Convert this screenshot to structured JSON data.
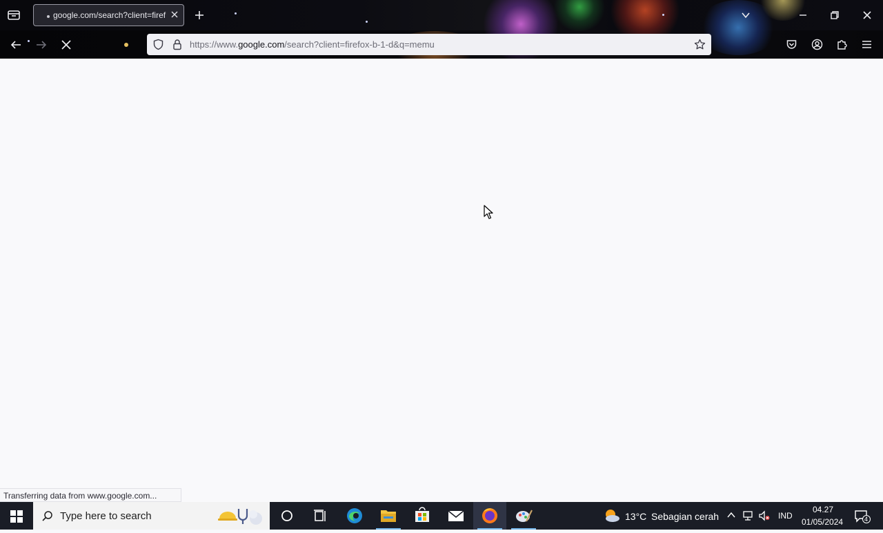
{
  "browser": {
    "tab": {
      "title": "google.com/search?client=firef"
    },
    "url": {
      "prefix": "https://www.",
      "domain": "google.com",
      "rest": "/search?client=firefox-b-1-d&q=memu"
    },
    "icons": {
      "tab_list": "tab-list-icon",
      "close_tab": "close-icon",
      "new_tab": "plus-icon",
      "list_all_tabs": "chevron-down-icon",
      "minimize": "minimize-icon",
      "restore": "restore-icon",
      "close_window": "close-icon",
      "back": "back-arrow-icon",
      "forward": "forward-arrow-icon",
      "stop": "stop-icon",
      "shield": "shield-icon",
      "lock": "lock-icon",
      "bookmark": "star-icon",
      "pocket": "pocket-icon",
      "account": "account-icon",
      "extensions": "extensions-icon",
      "menu": "hamburger-menu-icon"
    }
  },
  "status": {
    "text": "Transferring data from www.google.com..."
  },
  "taskbar": {
    "search_placeholder": "Type here to search",
    "weather": {
      "temp": "13°C",
      "desc": "Sebagian cerah"
    },
    "language": "IND",
    "time": "04.27",
    "date": "01/05/2024",
    "notifications": "4",
    "accent_color": "#76b9ed"
  }
}
